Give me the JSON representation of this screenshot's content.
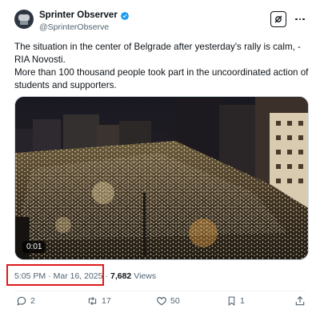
{
  "author": {
    "display_name": "Sprinter Observer",
    "handle": "@SprinterObserve",
    "avatar_icon": "observer-avatar",
    "verified_icon": "verified-badge-icon",
    "verified_color": "#1d9bf0"
  },
  "tweet": {
    "line1": "The situation in the center of Belgrade after yesterday's rally is calm, - RIA Novosti.",
    "line2": "More than 100 thousand people took part in the uncoordinated action of students and supporters."
  },
  "media": {
    "type": "video",
    "duration": "0:01"
  },
  "meta": {
    "time": "5:05 PM",
    "date": "Mar 16, 2025",
    "views_count": "7,682",
    "views_label": "Views",
    "separator": "·",
    "highlight_color": "#e0191b"
  },
  "actions": {
    "replies": "2",
    "reposts": "17",
    "likes": "50",
    "bookmarks": "1"
  },
  "colors": {
    "text": "#0f1419",
    "secondary": "#536471"
  }
}
